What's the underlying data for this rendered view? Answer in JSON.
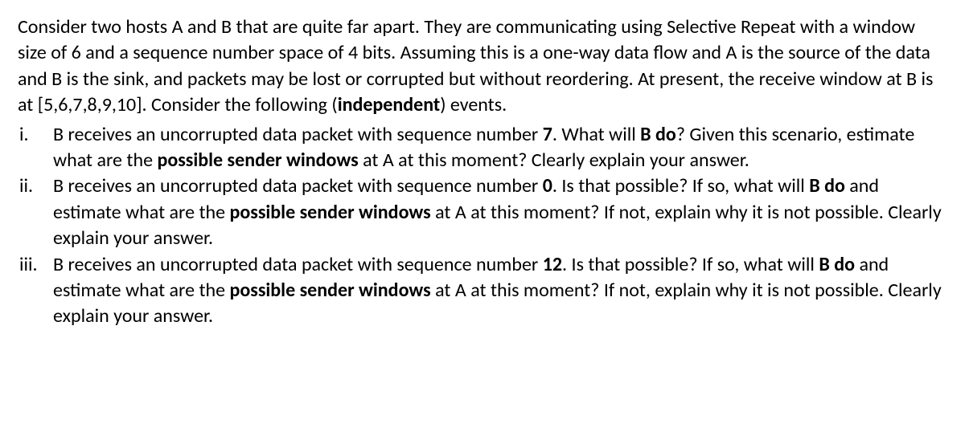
{
  "intro_html": "Consider two hosts A and B that are quite far apart. They are communicating using Selective Repeat with a window size of 6 and a sequence number space of 4 bits. Assuming this is a one-way data flow and A is the source of the data and B is the sink, and packets may be lost or corrupted but without reordering. At present, the receive window at B is at [5,6,7,8,9,10]. Consider the following (<b>independent</b>) events.",
  "items": [
    {
      "marker": "i.",
      "body_html": "B receives an uncorrupted data packet with sequence number <b>7</b>. What will <b>B do</b>? Given this scenario, estimate what are the <b>possible sender windows</b> at A at this moment? Clearly explain your answer."
    },
    {
      "marker": "ii.",
      "body_html": "B receives an uncorrupted data packet with sequence number <b>0</b>. Is that possible? If so, what will <b>B do</b> and estimate what are the <b>possible sender windows</b> at A at this moment? If not, explain why it is not possible. Clearly explain your answer."
    },
    {
      "marker": "iii.",
      "body_html": "B receives an uncorrupted data packet with sequence number <b>12</b>. Is that possible? If so, what will <b>B do</b> and estimate what are the <b>possible sender windows</b> at A at this moment? If not, explain why it is not possible. Clearly explain your answer."
    }
  ]
}
